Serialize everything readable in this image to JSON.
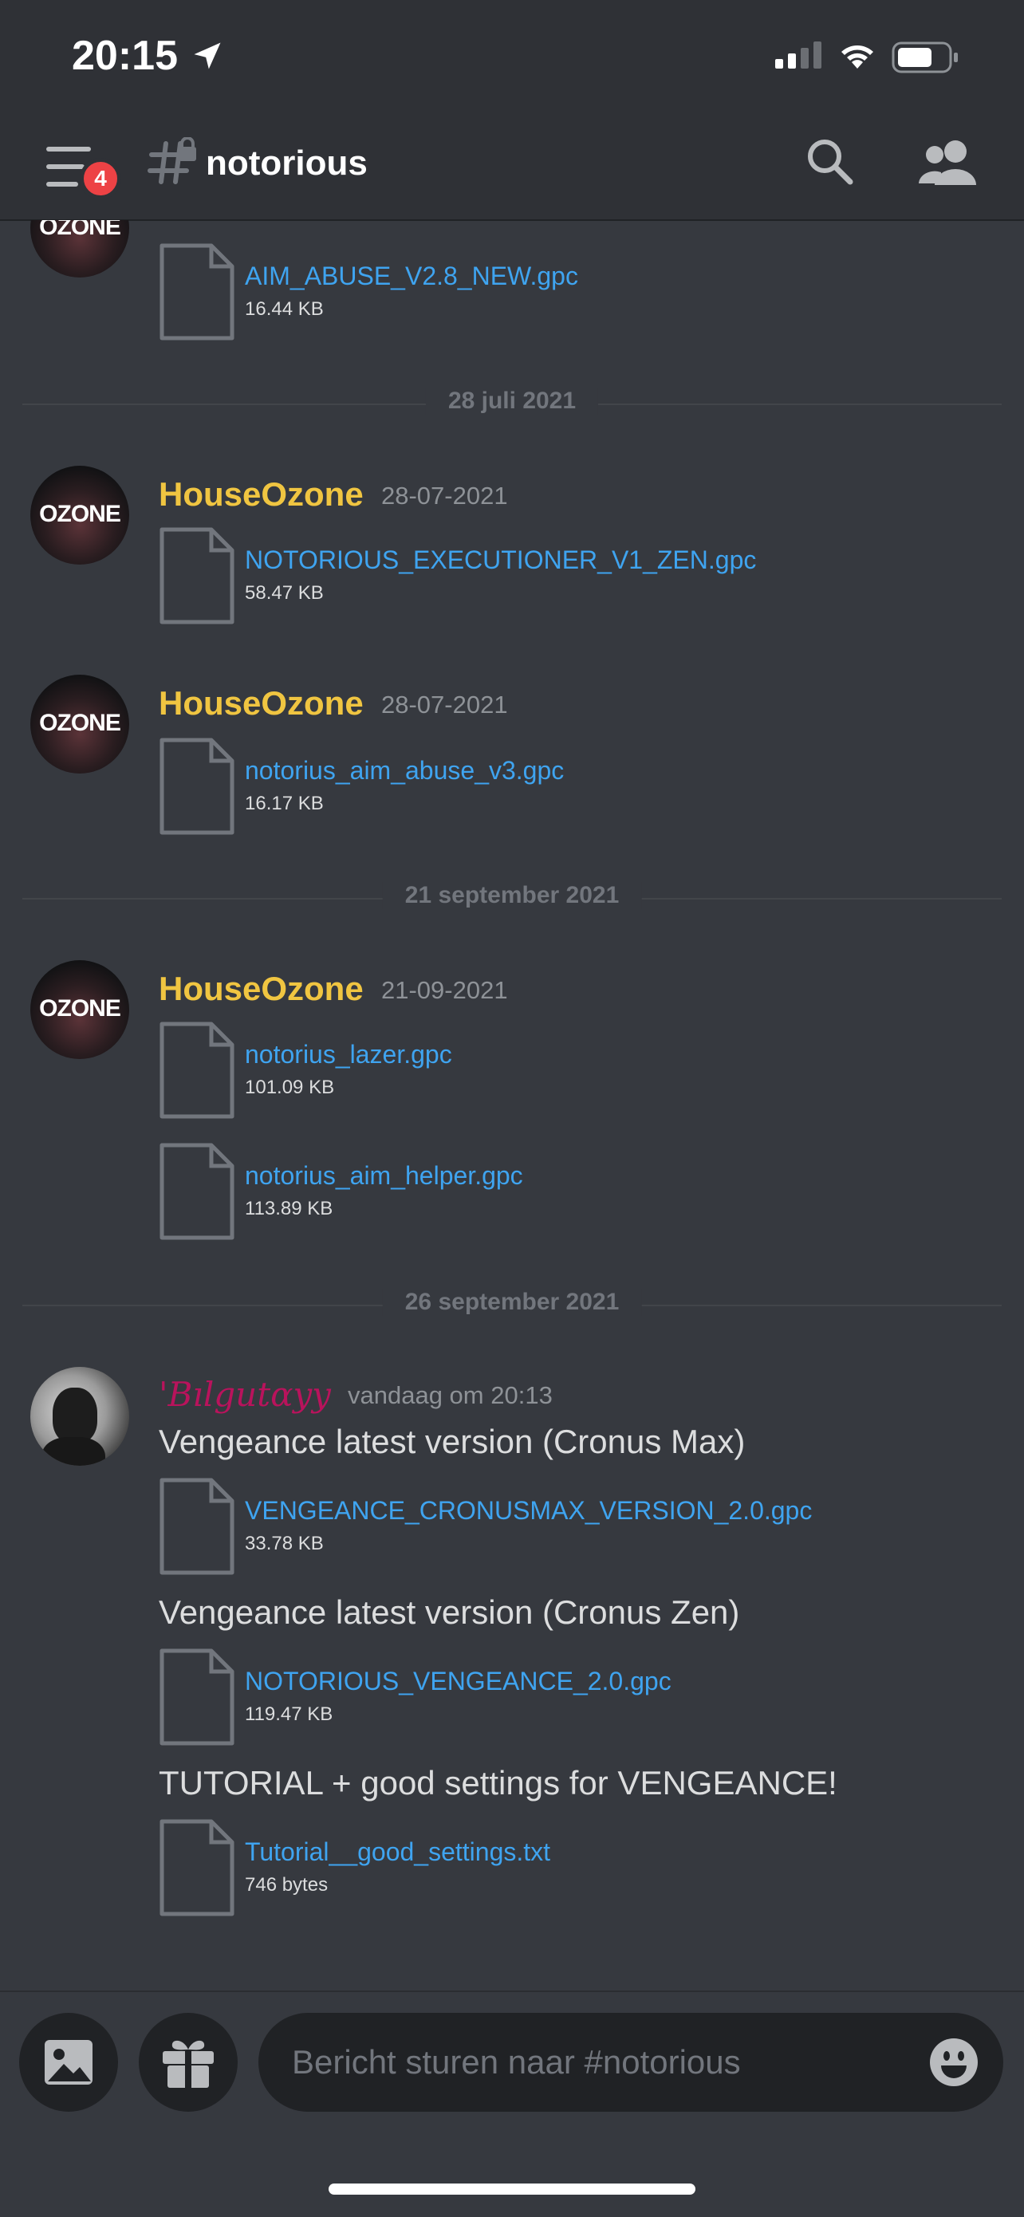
{
  "status_bar": {
    "time": "20:15"
  },
  "header": {
    "badge_count": "4",
    "channel_name": "notorious"
  },
  "dividers": [
    "28 juli 2021",
    "21 september 2021",
    "26 september 2021"
  ],
  "avatars": {
    "ozone_text": "OZONE"
  },
  "messages": [
    {
      "files": [
        {
          "name": "AIM_ABUSE_V2.8_NEW.gpc",
          "size": "16.44 KB"
        }
      ]
    },
    {
      "author": "HouseOzone",
      "timestamp": "28-07-2021",
      "files": [
        {
          "name": "NOTORIOUS_EXECUTIONER_V1_ZEN.gpc",
          "size": "58.47 KB"
        }
      ]
    },
    {
      "author": "HouseOzone",
      "timestamp": "28-07-2021",
      "files": [
        {
          "name": "notorius_aim_abuse_v3.gpc",
          "size": "16.17 KB"
        }
      ]
    },
    {
      "author": "HouseOzone",
      "timestamp": "21-09-2021",
      "files": [
        {
          "name": "notorius_lazer.gpc",
          "size": "101.09 KB"
        },
        {
          "name": "notorius_aim_helper.gpc",
          "size": "113.89 KB"
        }
      ]
    },
    {
      "author": "'Bılgutαyy",
      "timestamp": "vandaag om 20:13",
      "texts": [
        "Vengeance latest version (Cronus Max)",
        "Vengeance latest version (Cronus Zen)",
        "TUTORIAL + good settings for VENGEANCE!"
      ],
      "files": [
        {
          "name": "VENGEANCE_CRONUSMAX_VERSION_2.0.gpc",
          "size": "33.78 KB"
        },
        {
          "name": "NOTORIOUS_VENGEANCE_2.0.gpc",
          "size": "119.47 KB"
        },
        {
          "name": "Tutorial__good_settings.txt",
          "size": "746 bytes"
        }
      ]
    }
  ],
  "composer": {
    "placeholder": "Bericht sturen naar #notorious"
  },
  "colors": {
    "background": "#36393f",
    "header": "#2f3136",
    "link": "#3fa4f0",
    "author_gold": "#f0c541",
    "author_pink": "#b9135c",
    "badge": "#ed4245"
  }
}
